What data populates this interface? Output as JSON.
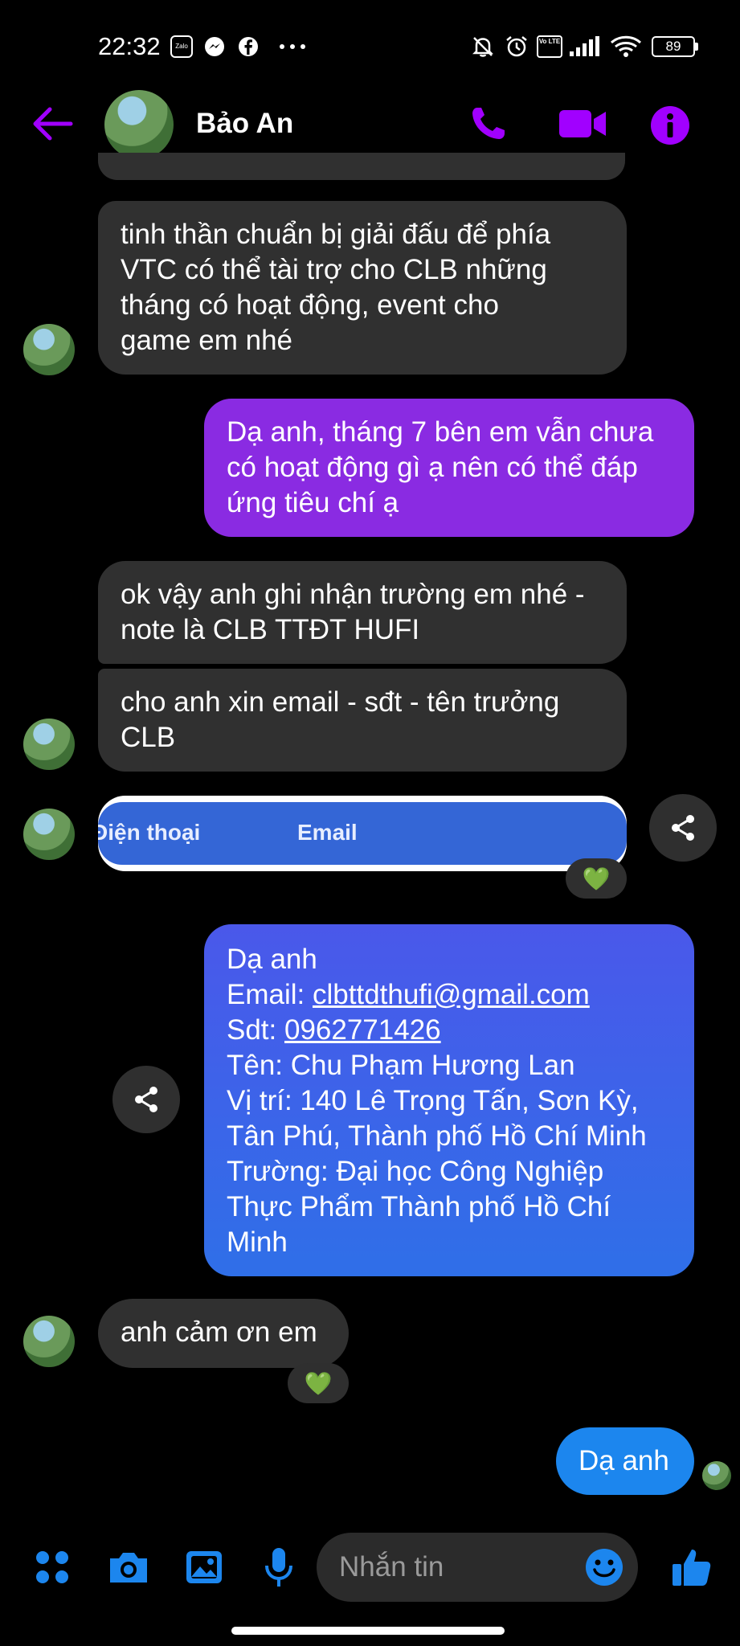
{
  "status_bar": {
    "time": "22:32",
    "app_icons": [
      "zalo-icon",
      "messenger-icon",
      "facebook-icon",
      "more-dots-icon"
    ],
    "zalo_label": "Zalo",
    "volte_label": "Vo LTE",
    "battery": "89"
  },
  "header": {
    "contact_name": "Bảo An",
    "accent_color": "#a100ff"
  },
  "messages": {
    "m1_lines": [
      "tinh thần chuẩn bị giải đấu để phía",
      "VTC có thể tài trợ cho CLB những",
      "tháng có hoạt động, event cho",
      "game em nhé"
    ],
    "m2_lines": [
      "Dạ anh, tháng 7 bên em vẫn chưa",
      "có hoạt động gì ạ nên có thể đáp",
      "ứng tiêu chí ạ"
    ],
    "m3_lines": [
      "ok vậy anh ghi nhận trường em nhé -",
      "note là CLB TTĐT HUFI"
    ],
    "m4_lines": [
      "cho anh xin email - sđt - tên trưởng",
      "CLB"
    ],
    "form_tabs": [
      "Điện thoại",
      "Email"
    ],
    "m6": {
      "greeting": "Dạ anh",
      "email_label": "Email: ",
      "email": "clbttdthufi@gmail.com",
      "phone_label": "Sdt: ",
      "phone": "0962771426",
      "lines": [
        "Tên: Chu Phạm Hương Lan",
        "Vị trí: 140 Lê Trọng Tấn, Sơn Kỳ,",
        "Tân Phú, Thành phố Hồ Chí Minh",
        "Trường: Đại học Công Nghiệp",
        "Thực Phẩm Thành phố Hồ Chí",
        "Minh"
      ]
    },
    "m7": "anh cảm ơn em",
    "m8": "Dạ anh",
    "reaction": "💚"
  },
  "composer": {
    "placeholder": "Nhắn tin"
  },
  "colors": {
    "accent": "#a100ff",
    "outgoing_purple": "#8a2be2",
    "outgoing_blue": "#2f6fe8",
    "composer_blue": "#1c86ee",
    "incoming": "#303030"
  }
}
